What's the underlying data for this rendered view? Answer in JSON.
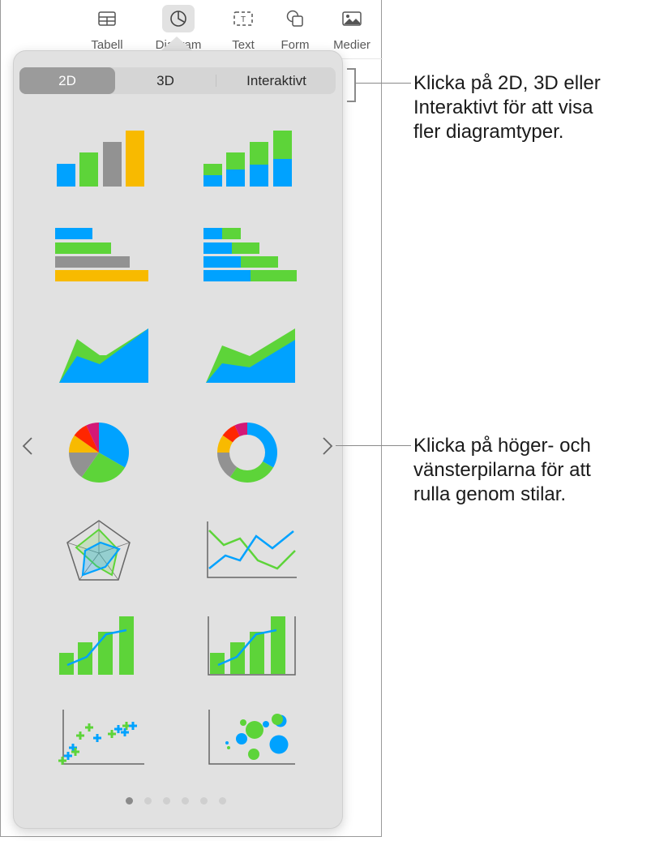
{
  "toolbar": {
    "items": [
      {
        "label": "Tabell",
        "icon": "table-icon"
      },
      {
        "label": "Diagram",
        "icon": "chart-icon",
        "active": true
      },
      {
        "label": "Text",
        "icon": "text-box-icon"
      },
      {
        "label": "Form",
        "icon": "shape-icon"
      },
      {
        "label": "Medier",
        "icon": "media-icon"
      }
    ]
  },
  "popover": {
    "segments": [
      {
        "label": "2D",
        "active": true
      },
      {
        "label": "3D",
        "active": false
      },
      {
        "label": "Interaktivt",
        "active": false
      }
    ],
    "chart_types": [
      "column",
      "stacked-column",
      "bar",
      "stacked-bar",
      "area",
      "stacked-area",
      "pie",
      "donut",
      "radar",
      "line",
      "mixed",
      "two-axis",
      "scatter",
      "bubble"
    ],
    "nav": {
      "prev_icon": "chevron-left-icon",
      "next_icon": "chevron-right-icon"
    },
    "pages": {
      "count": 6,
      "current": 1
    }
  },
  "callouts": {
    "top": {
      "lines": [
        "Klicka på 2D, 3D eller",
        "Interaktivt för att visa",
        "fler diagramtyper."
      ]
    },
    "middle": {
      "lines": [
        "Klicka på höger- och",
        "vänsterpilarna för att",
        "rulla genom stilar."
      ]
    }
  },
  "colors": {
    "blue": "#00a2ff",
    "green": "#5dd439",
    "gray": "#929292",
    "yellow": "#f8ba00",
    "red": "#ff2600",
    "magenta": "#d31876",
    "popover_bg": "#e1e1e1",
    "segment_active": "#9b9b9b"
  }
}
